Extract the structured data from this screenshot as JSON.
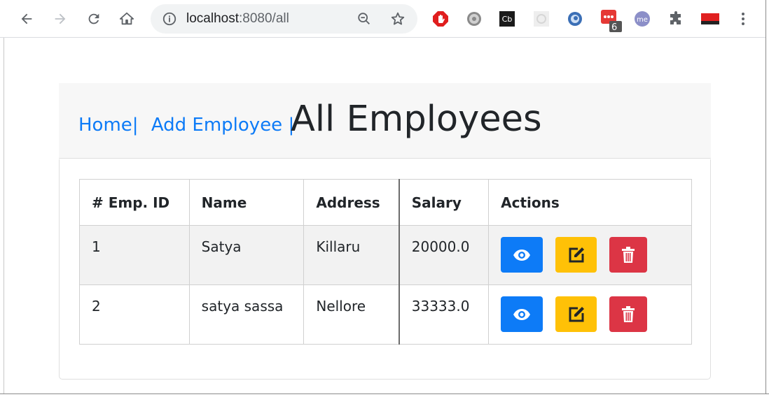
{
  "browser": {
    "url_host": "localhost",
    "url_rest": ":8080/all",
    "extension_badge": "6"
  },
  "nav": {
    "home_label": "Home|",
    "add_label": "Add Employee |"
  },
  "page_title": "All Employees",
  "table": {
    "headers": [
      "# Emp. ID",
      "Name",
      "Address",
      "Salary",
      "Actions"
    ],
    "rows": [
      {
        "id": "1",
        "name": "Satya",
        "address": "Killaru",
        "salary": "20000.0"
      },
      {
        "id": "2",
        "name": "satya sassa",
        "address": "Nellore",
        "salary": "33333.0"
      }
    ]
  },
  "icons": {
    "view": "eye-icon",
    "edit": "edit-icon",
    "delete": "trash-icon"
  },
  "colors": {
    "primary": "#0d7bf7",
    "warning": "#ffc107",
    "danger": "#dc3545"
  }
}
